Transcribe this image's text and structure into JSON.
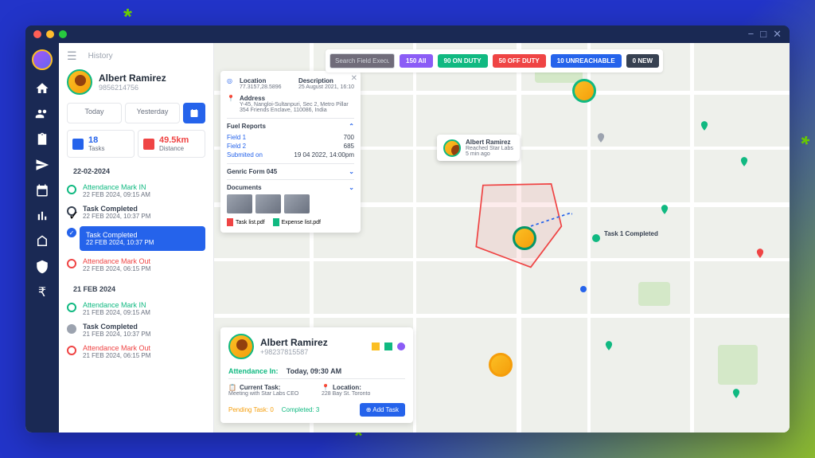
{
  "breadcrumb": "History",
  "user": {
    "name": "Albert Ramirez",
    "phone": "9856214756"
  },
  "tabs": {
    "today": "Today",
    "yesterday": "Yesterday"
  },
  "stats": {
    "tasks_val": "18",
    "tasks_lbl": "Tasks",
    "dist_val": "49.5km",
    "dist_lbl": "Distance"
  },
  "timeline": {
    "date1": "22-02-2024",
    "date2": "21 FEB 2024",
    "items": [
      {
        "title": "Attendance Mark IN",
        "time": "22 FEB 2024, 09:15 AM",
        "type": "green"
      },
      {
        "title": "Task Completed",
        "time": "22 FEB 2024, 10:37 PM",
        "type": "check"
      },
      {
        "title": "Task Completed",
        "time": "22 FEB 2024, 10:37 PM",
        "type": "active"
      },
      {
        "title": "Attendance Mark Out",
        "time": "22 FEB 2024, 06:15 PM",
        "type": "red"
      },
      {
        "title": "Attendance Mark IN",
        "time": "21 FEB 2024, 09:15 AM",
        "type": "green-hollow"
      },
      {
        "title": "Task Completed",
        "time": "21 FEB 2024, 10:37 PM",
        "type": "gray"
      },
      {
        "title": "Attendance Mark Out",
        "time": "21 FEB 2024, 06:15 PM",
        "type": "red-hollow"
      }
    ]
  },
  "search": {
    "placeholder": "Search Field Executive"
  },
  "pills": {
    "all": "150 All",
    "on": "90 ON DUTY",
    "off": "50 OFF DUTY",
    "unr": "10 UNREACHABLE",
    "new": "0 NEW"
  },
  "infocard": {
    "location_lbl": "Location",
    "location_val": "77.3157,28.5896",
    "desc_lbl": "Description",
    "desc_val": "25 August 2021, 16:10",
    "addr_lbl": "Address",
    "addr_val": "Y-45, Nangloi-Sultanpuri, Sec 2, Metro Pillar 354 Friends Enclave, 110086, India",
    "fuel_hdr": "Fuel Reports",
    "field1_lbl": "Field 1",
    "field1_val": "700",
    "field2_lbl": "Field 2",
    "field2_val": "685",
    "submit_lbl": "Submited on",
    "submit_val": "19 04 2022, 14:00pm",
    "form_hdr": "Genric Form 045",
    "docs_hdr": "Documents",
    "pdf1": "Task list.pdf",
    "pdf2": "Expense list.pdf"
  },
  "bottomcard": {
    "name": "Albert Ramirez",
    "phone": "+98237815587",
    "att_lbl": "Attendance In:",
    "att_val": "Today, 09:30 AM",
    "ct_lbl": "Current Task:",
    "ct_val": "Meeting with  Star Labs CEO",
    "loc_lbl": "Location:",
    "loc_val": "228 Bay St. Toronto",
    "pending": "Pending Task: 0",
    "completed": "Completed: 3",
    "addtask": "Add Task"
  },
  "popup": {
    "name": "Albert Ramirez",
    "sub": "Reached Star Labs",
    "time": "5 min ago"
  },
  "taskmarker": "Task 1 Completed",
  "colors": {
    "primary": "#2563eb",
    "success": "#10b981",
    "danger": "#ef4444",
    "warning": "#f59e0b"
  }
}
